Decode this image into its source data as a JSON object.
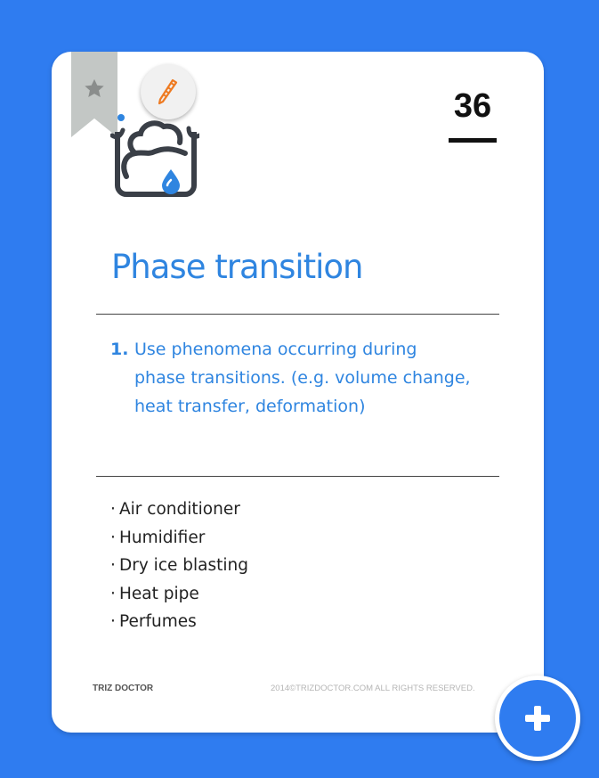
{
  "card": {
    "number": "36",
    "title": "Phase transition",
    "principle": {
      "number": "1.",
      "text": "Use phenomena occurring during\nphase transitions. (e.g. volume change,\nheat transfer, deformation)"
    },
    "examples": [
      "Air conditioner",
      "Humidifier",
      "Dry ice blasting",
      "Heat pipe",
      "Perfumes"
    ],
    "bullet": "·",
    "footer": {
      "brand": "TRIZ DOCTOR",
      "copyright": "2014©TRIZDOCTOR.COM  ALL RIGHTS RESERVED."
    }
  },
  "icons": {
    "bookmark": "star-bookmark-icon",
    "edit": "pencil-icon",
    "principle": "phase-transition-icon",
    "add": "plus-icon"
  },
  "colors": {
    "background": "#2f7cf0",
    "title": "#2f85e0",
    "pencil": "#ee7b22",
    "bookmark": "#c3c7c5",
    "icon_stroke": "#3a3f47",
    "droplet": "#2f85e0"
  }
}
